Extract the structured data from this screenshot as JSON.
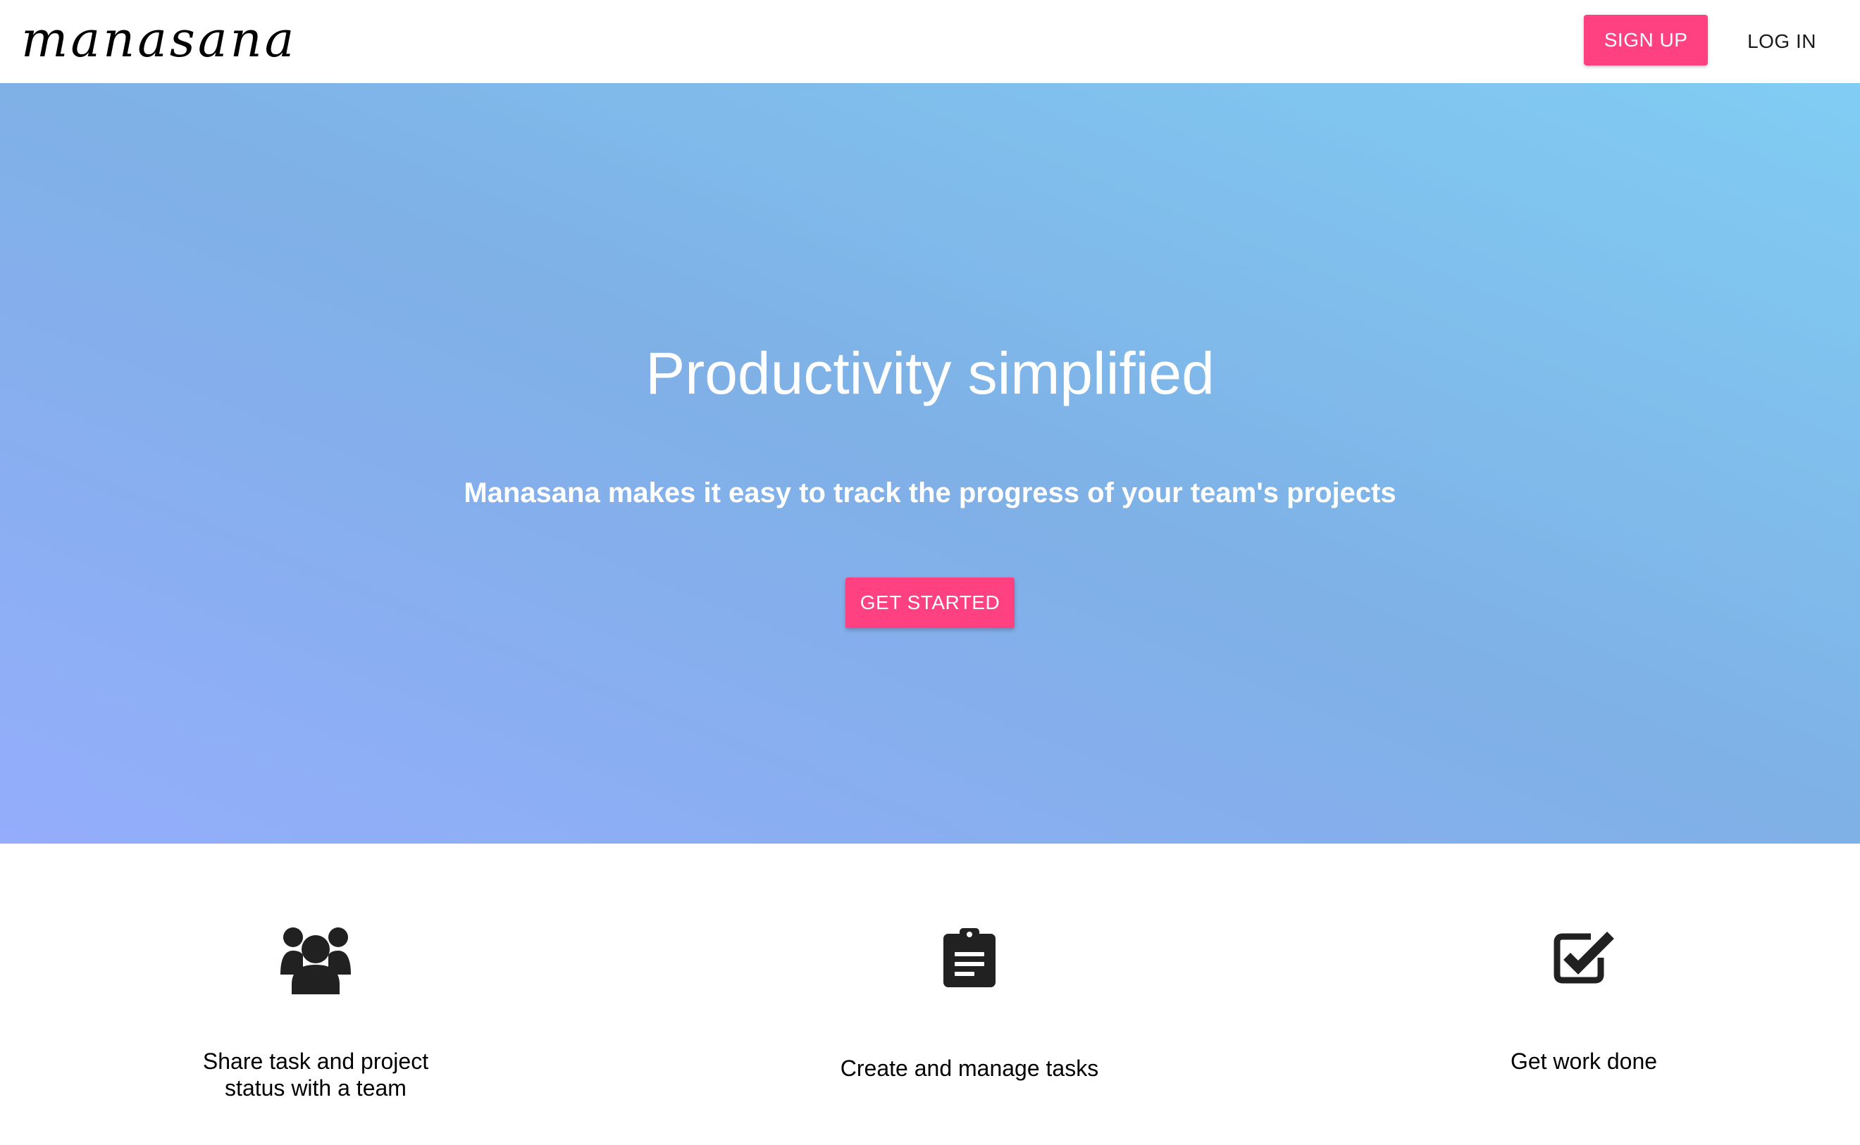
{
  "header": {
    "logo": "manasana",
    "signup_label": "SIGN UP",
    "login_label": "LOG IN"
  },
  "hero": {
    "title": "Productivity simplified",
    "subtitle": "Manasana makes it easy to track the progress of your team's projects",
    "cta_label": "GET STARTED"
  },
  "features": [
    {
      "icon": "users-icon",
      "label": "Share task and project status with a team"
    },
    {
      "icon": "clipboard-icon",
      "label": "Create and manage tasks"
    },
    {
      "icon": "checkbox-checked-icon",
      "label": "Get work done"
    }
  ],
  "colors": {
    "accent": "#ff4081",
    "hero_gradient_start": "#94adfc",
    "hero_gradient_mid": "#7fb0e6",
    "hero_gradient_end": "#80cdf4",
    "icon": "#212121"
  }
}
